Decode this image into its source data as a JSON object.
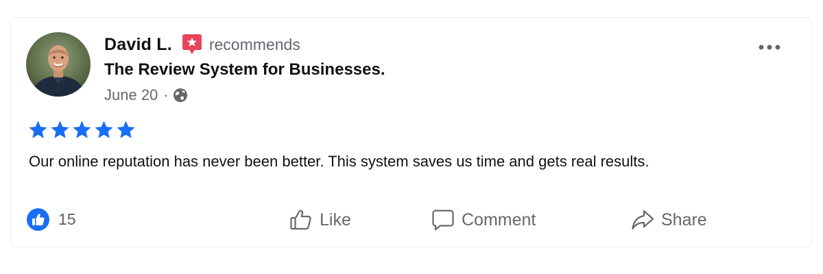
{
  "post": {
    "author": "David L.",
    "action_text": "recommends",
    "business_name": "The Review System for Businesses.",
    "date": "June 20",
    "separator": "·",
    "audience_icon": "globe-icon",
    "rating": 5,
    "review_text": "Our online reputation has never been better. This system saves us time and gets real results."
  },
  "reactions": {
    "like_count": "15",
    "icon": "thumbs-up-icon"
  },
  "actions": {
    "like_label": "Like",
    "comment_label": "Comment",
    "share_label": "Share"
  },
  "colors": {
    "star": "#1a6ef5",
    "badge": "#e8445a",
    "like_circle": "#1a6ef5",
    "muted_text": "#65676b",
    "primary_text": "#111111"
  }
}
